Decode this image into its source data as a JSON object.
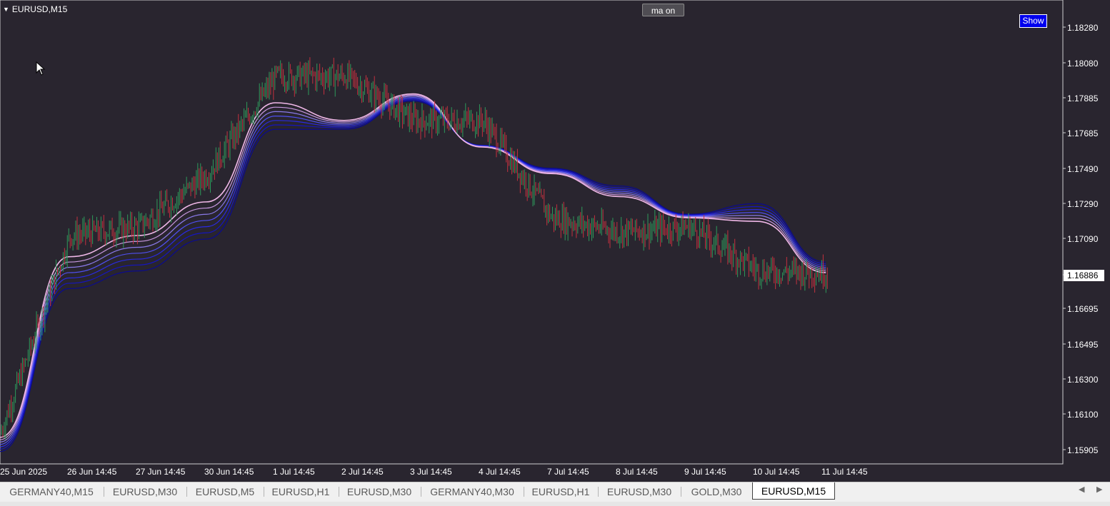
{
  "chart": {
    "symbol": "EURUSD,M15",
    "ma_button": "ma on",
    "show_button": "Show",
    "current_price": "1.16886",
    "price_labels": [
      "1.18280",
      "1.18080",
      "1.17885",
      "1.17685",
      "1.17490",
      "1.17290",
      "1.17090",
      "1.16695",
      "1.16495",
      "1.16300",
      "1.16100",
      "1.15905"
    ],
    "time_labels": [
      "25 Jun 2025",
      "26 Jun 14:45",
      "27 Jun 14:45",
      "30 Jun 14:45",
      "1 Jul 14:45",
      "2 Jul 14:45",
      "3 Jul 14:45",
      "4 Jul 14:45",
      "7 Jul 14:45",
      "8 Jul 14:45",
      "9 Jul 14:45",
      "10 Jul 14:45",
      "11 Jul 14:45"
    ],
    "colors": {
      "background": "#29252f",
      "bull_candle": "#2e9a5b",
      "bear_candle": "#c4313f",
      "ma_light": "#f0b8e8",
      "ma_dark": "#1010d0"
    }
  },
  "chart_data": {
    "type": "candlestick",
    "symbol": "EURUSD",
    "timeframe": "M15",
    "ylim": [
      1.1585,
      1.1835
    ],
    "x": [
      "25 Jun 2025",
      "26 Jun 14:45",
      "27 Jun 14:45",
      "30 Jun 14:45",
      "1 Jul 14:45",
      "2 Jul 14:45",
      "3 Jul 14:45",
      "4 Jul 14:45",
      "7 Jul 14:45",
      "8 Jul 14:45",
      "9 Jul 14:45",
      "10 Jul 14:45",
      "11 Jul 14:45"
    ],
    "close": [
      1.16,
      1.171,
      1.1715,
      1.1745,
      1.18,
      1.18,
      1.1775,
      1.1775,
      1.172,
      1.1712,
      1.1715,
      1.169,
      1.1689
    ],
    "ma_upper": [
      1.1596,
      1.1698,
      1.171,
      1.1729,
      1.1785,
      1.1775,
      1.179,
      1.176,
      1.1745,
      1.1732,
      1.172,
      1.1718,
      1.1689
    ],
    "ma_lower": [
      1.1588,
      1.168,
      1.169,
      1.1708,
      1.177,
      1.177,
      1.1786,
      1.1761,
      1.1748,
      1.1738,
      1.1722,
      1.1728,
      1.1695
    ],
    "last_price": 1.16886
  },
  "tabs": [
    {
      "label": "GERMANY40,M15"
    },
    {
      "label": "EURUSD,M30"
    },
    {
      "label": "EURUSD,M5"
    },
    {
      "label": "EURUSD,H1"
    },
    {
      "label": "EURUSD,M30"
    },
    {
      "label": "GERMANY40,M30"
    },
    {
      "label": "EURUSD,H1"
    },
    {
      "label": "EURUSD,M30"
    },
    {
      "label": "GOLD,M30"
    },
    {
      "label": "EURUSD,M15"
    }
  ]
}
